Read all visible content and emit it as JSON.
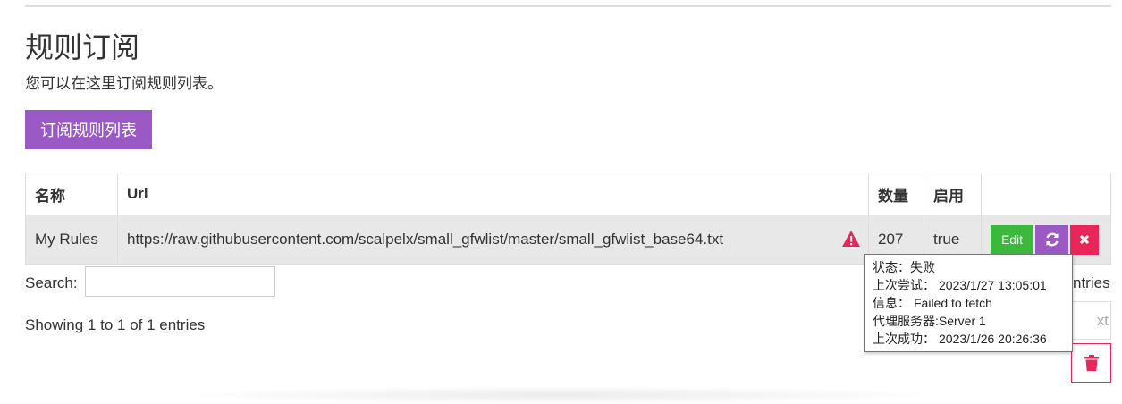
{
  "header": {
    "title": "规则订阅",
    "subtitle": "您可以在这里订阅规则列表。",
    "subscribe_label": "订阅规则列表"
  },
  "table": {
    "headers": [
      "名称",
      "Url",
      "数量",
      "启用",
      ""
    ],
    "rows": [
      {
        "name": "My Rules",
        "url": "https://raw.githubusercontent.com/scalpelx/small_gfwlist/master/small_gfwlist_base64.txt",
        "count": "207",
        "enabled": "true",
        "edit_label": "Edit"
      }
    ]
  },
  "search": {
    "label": "Search:",
    "value": ""
  },
  "pagination": {
    "showing": "Showing 1 to 1 of 1 entries",
    "entries_partial": "ntries",
    "next_partial": "xt"
  },
  "tooltip": {
    "status_label": "状态：",
    "status_value": "失败",
    "last_try_label": "上次尝试：",
    "last_try_value": "2023/1/27 13:05:01",
    "info_label": "信息：",
    "info_value": "Failed to fetch",
    "proxy_label": "代理服务器:",
    "proxy_value": "Server 1",
    "last_success_label": "上次成功：",
    "last_success_value": "2023/1/26 20:26:36"
  },
  "colors": {
    "purple": "#9b59c6",
    "green": "#3cb83c",
    "red": "#e8265a"
  },
  "icons": [
    "warning-icon",
    "refresh-icon",
    "close-icon",
    "trash-icon"
  ]
}
